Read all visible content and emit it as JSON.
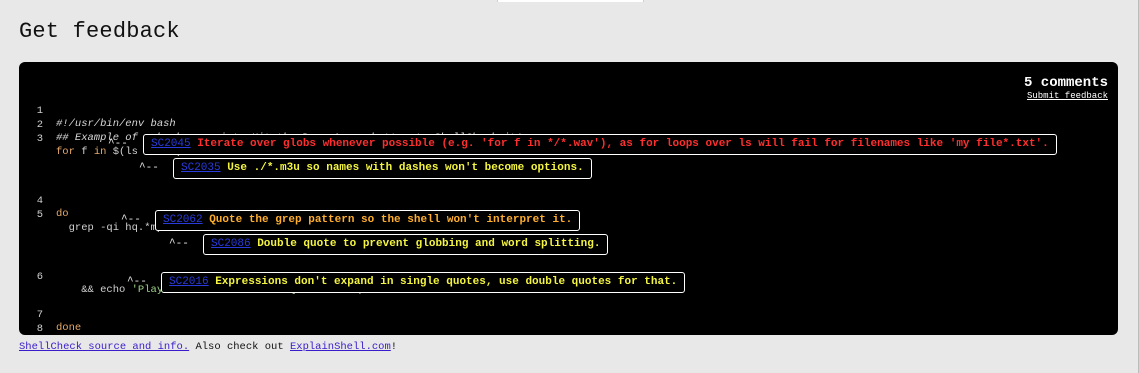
{
  "page": {
    "title": "Get feedback"
  },
  "panel": {
    "comments_count": "5 comments",
    "submit_feedback": "Submit feedback"
  },
  "code_lines": [
    {
      "num": "1",
      "text": "#!/usr/bin/env bash"
    },
    {
      "num": "2",
      "text": "## Example of a broken script. Hit the Down Arrow button to ShellCheck it!"
    },
    {
      "num": "3",
      "kw": "for",
      "mid": " f ",
      "kw2": "in",
      "rest": " $(ls *.m3u)"
    },
    {
      "num": "4",
      "kw": "do"
    },
    {
      "num": "5",
      "text": "  grep -qi hq.*mp3 $f \\"
    },
    {
      "num": "6",
      "pre": "    && echo ",
      "str": "'Playlist $f contains a HQ file in mp3 format'"
    },
    {
      "num": "7",
      "kw": "done"
    },
    {
      "num": "8",
      "text": ""
    }
  ],
  "notes": [
    {
      "caret": "^-- ",
      "code": "SC2045",
      "message": " Iterate over globs whenever possible (e.g. 'for f in */*.wav'), as for loops over ls will fail for filenames like 'my file*.txt'.",
      "severity": "error",
      "color": "#ff2e2e"
    },
    {
      "caret": "^-- ",
      "code": "SC2035",
      "message": " Use ./*.m3u so names with dashes won't become options.",
      "severity": "warning",
      "color": "#f4f441"
    },
    {
      "caret": "^-- ",
      "code": "SC2062",
      "message": " Quote the grep pattern so the shell won't interpret it.",
      "severity": "warning",
      "color": "#ffae2e"
    },
    {
      "caret": "^-- ",
      "code": "SC2086",
      "message": " Double quote to prevent globbing and word splitting.",
      "severity": "info",
      "color": "#f4f441"
    },
    {
      "caret": "^-- ",
      "code": "SC2016",
      "message": " Expressions don't expand in single quotes, use double quotes for that.",
      "severity": "info",
      "color": "#f4f441"
    }
  ],
  "footer": {
    "source_link": "ShellCheck source and info.",
    "middle_text": " Also check out ",
    "explain_link": "ExplainShell.com",
    "end_text": "!"
  }
}
